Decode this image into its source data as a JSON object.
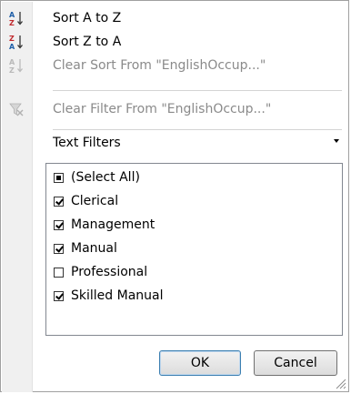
{
  "menu": {
    "sort_az": "Sort A to Z",
    "sort_za": "Sort Z to A",
    "clear_sort": "Clear Sort From \"EnglishOccup...\"",
    "clear_filter": "Clear Filter From \"EnglishOccup...\"",
    "text_filters": "Text Filters"
  },
  "filter_list": {
    "items": [
      {
        "label": "(Select All)",
        "state": "partial"
      },
      {
        "label": "Clerical",
        "state": "checked"
      },
      {
        "label": "Management",
        "state": "checked"
      },
      {
        "label": "Manual",
        "state": "checked"
      },
      {
        "label": "Professional",
        "state": "unchecked"
      },
      {
        "label": "Skilled Manual",
        "state": "checked"
      }
    ]
  },
  "buttons": {
    "ok": "OK",
    "cancel": "Cancel"
  },
  "colors": {
    "sort_icon_blue": "#1f5fa8",
    "sort_icon_red": "#c0282c",
    "disabled_text": "#8a8a8a",
    "gutter": "#f0f0f0"
  }
}
